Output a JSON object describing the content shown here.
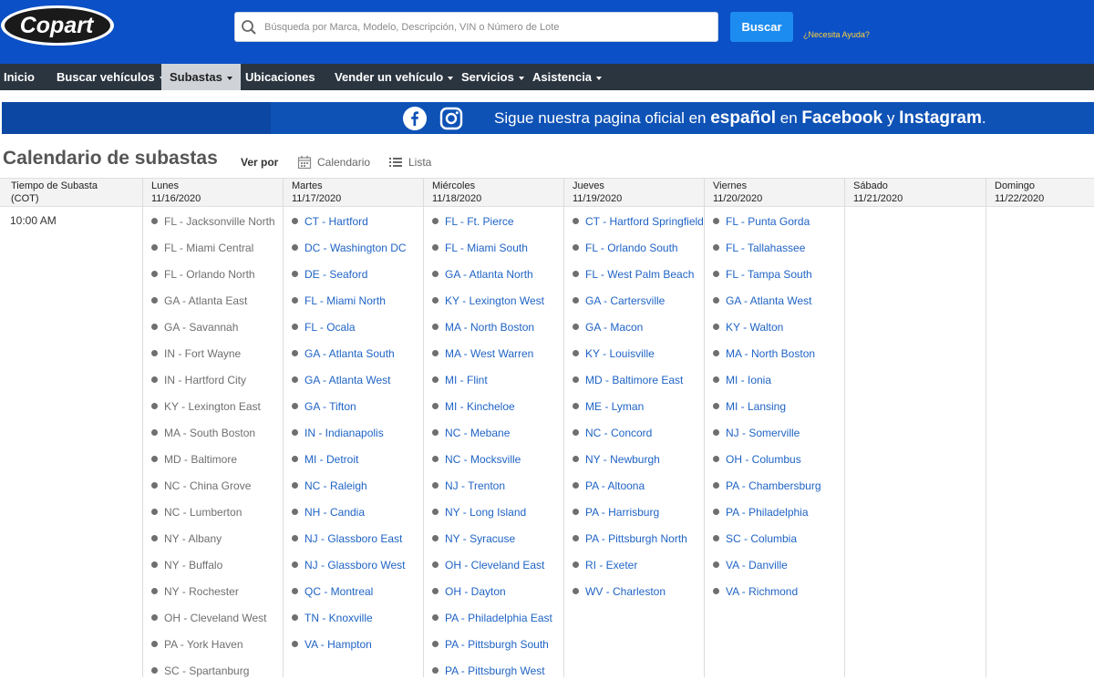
{
  "header": {
    "logo_text": "Copart",
    "search_placeholder": "Búsqueda por Marca, Modelo, Descripción, VIN o Número de Lote",
    "search_button": "Buscar",
    "help_link": "¿Necesita Ayuda?"
  },
  "nav": {
    "items": [
      {
        "label": "Inicio"
      },
      {
        "label": "Buscar vehículos"
      },
      {
        "label": "Subastas"
      },
      {
        "label": "Ubicaciones"
      },
      {
        "label": "Vender un vehículo"
      },
      {
        "label": "Servicios"
      },
      {
        "label": "Asistencia"
      }
    ]
  },
  "banner": {
    "text_prefix": "Sigue nuestra pagina oficial en ",
    "text_bold1": "español",
    "text_mid": " en ",
    "text_bold2": "Facebook",
    "text_y": " y ",
    "text_bold3": "Instagram",
    "text_end": "."
  },
  "page": {
    "title": "Calendario de subastas",
    "view_by": "Ver por",
    "view_calendar": "Calendario",
    "view_list": "Lista"
  },
  "calendar": {
    "time_header_line1": "Tiempo de Subasta",
    "time_header_line2": "(COT)",
    "time": "10:00 AM",
    "days": [
      {
        "name": "Lunes",
        "date": "11/16/2020",
        "auctions": [
          "FL - Jacksonville North",
          "FL - Miami Central",
          "FL - Orlando North",
          "GA - Atlanta East",
          "GA - Savannah",
          "IN - Fort Wayne",
          "IN - Hartford City",
          "KY - Lexington East",
          "MA - South Boston",
          "MD - Baltimore",
          "NC - China Grove",
          "NC - Lumberton",
          "NY - Albany",
          "NY - Buffalo",
          "NY - Rochester",
          "OH - Cleveland West",
          "PA - York Haven",
          "SC - Spartanburg"
        ]
      },
      {
        "name": "Martes",
        "date": "11/17/2020",
        "auctions": [
          "CT - Hartford",
          "DC - Washington DC",
          "DE - Seaford",
          "FL - Miami North",
          "FL - Ocala",
          "GA - Atlanta South",
          "GA - Atlanta West",
          "GA - Tifton",
          "IN - Indianapolis",
          "MI - Detroit",
          "NC - Raleigh",
          "NH - Candia",
          "NJ - Glassboro East",
          "NJ - Glassboro West",
          "QC - Montreal",
          "TN - Knoxville",
          "VA - Hampton"
        ]
      },
      {
        "name": "Miércoles",
        "date": "11/18/2020",
        "auctions": [
          "FL - Ft. Pierce",
          "FL - Miami South",
          "GA - Atlanta North",
          "KY - Lexington West",
          "MA - North Boston",
          "MA - West Warren",
          "MI - Flint",
          "MI - Kincheloe",
          "NC - Mebane",
          "NC - Mocksville",
          "NJ - Trenton",
          "NY - Long Island",
          "NY - Syracuse",
          "OH - Cleveland East",
          "OH - Dayton",
          "PA - Philadelphia East",
          "PA - Pittsburgh South",
          "PA - Pittsburgh West"
        ]
      },
      {
        "name": "Jueves",
        "date": "11/19/2020",
        "auctions": [
          "CT - Hartford Springfield",
          "FL - Orlando South",
          "FL - West Palm Beach",
          "GA - Cartersville",
          "GA - Macon",
          "KY - Louisville",
          "MD - Baltimore East",
          "ME - Lyman",
          "NC - Concord",
          "NY - Newburgh",
          "PA - Altoona",
          "PA - Harrisburg",
          "PA - Pittsburgh North",
          "RI - Exeter",
          "WV - Charleston"
        ]
      },
      {
        "name": "Viernes",
        "date": "11/20/2020",
        "auctions": [
          "FL - Punta Gorda",
          "FL - Tallahassee",
          "FL - Tampa South",
          "GA - Atlanta West",
          "KY - Walton",
          "MA - North Boston",
          "MI - Ionia",
          "MI - Lansing",
          "NJ - Somerville",
          "OH - Columbus",
          "PA - Chambersburg",
          "PA - Philadelphia",
          "SC - Columbia",
          "VA - Danville",
          "VA - Richmond"
        ]
      },
      {
        "name": "Sábado",
        "date": "11/21/2020",
        "auctions": []
      },
      {
        "name": "Domingo",
        "date": "11/22/2020",
        "auctions": []
      }
    ]
  },
  "colors": {
    "header_blue": "#0b50c6",
    "nav_dark": "#2b3540",
    "link_blue": "#1f63c5",
    "past_gray": "#6f6f6f",
    "help_yellow": "#ffd23b"
  }
}
